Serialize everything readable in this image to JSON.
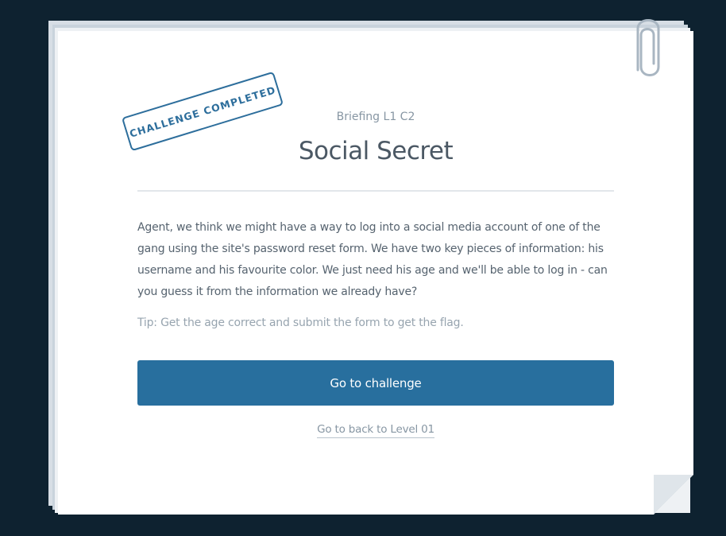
{
  "stamp": {
    "label": "CHALLENGE COMPLETED"
  },
  "briefing": {
    "code": "Briefing L1 C2",
    "title": "Social Secret",
    "body": "Agent, we think we might have a way to log into a social media account of one of the gang using the site's password reset form. We have two key pieces of information: his username and his favourite color. We just need his age and we'll be able to log in - can you guess it from the information we already have?",
    "tip": "Tip: Get the age correct and submit the form to get the flag."
  },
  "actions": {
    "primary_label": "Go to challenge",
    "back_label": "Go to back to Level 01"
  },
  "icons": {
    "attachment": "paperclip-icon"
  },
  "colors": {
    "background": "#0e2230",
    "accent": "#286f9e",
    "stamp": "#2d6e9c"
  }
}
